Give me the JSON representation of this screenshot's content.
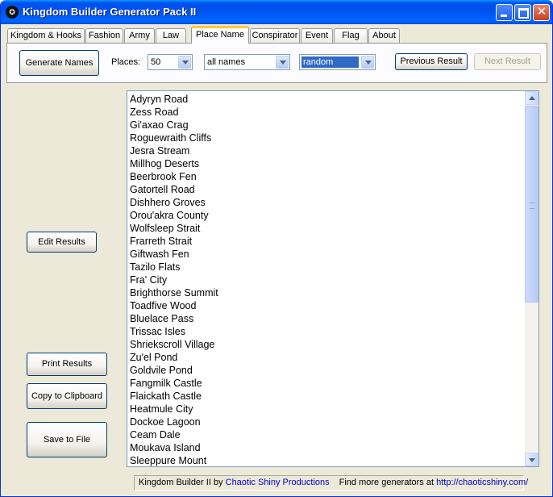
{
  "window": {
    "title": "Kingdom Builder Generator Pack II",
    "icon_glyph": "✪"
  },
  "tabs": [
    {
      "label": "Kingdom & Hooks",
      "active": false
    },
    {
      "label": "Fashion",
      "active": false
    },
    {
      "label": "Army",
      "active": false
    },
    {
      "label": "Law",
      "active": false
    },
    {
      "label": "Place Name",
      "active": true
    },
    {
      "label": "Conspirator",
      "active": false
    },
    {
      "label": "Event",
      "active": false
    },
    {
      "label": "Flag",
      "active": false
    },
    {
      "label": "About",
      "active": false
    }
  ],
  "toolbar": {
    "generate_label": "Generate Names",
    "places_label": "Places:",
    "places_value": "50",
    "filter_value": "all names",
    "style_value": "random",
    "previous_label": "Previous Result",
    "next_label": "Next Result"
  },
  "side_buttons": {
    "edit": "Edit Results",
    "print": "Print Results",
    "copy": "Copy to Clipboard",
    "save": "Save to File"
  },
  "results": [
    "Adyryn Road",
    "Zess Road",
    "Gi'axao Crag",
    "Roguewraith Cliffs",
    "Jesra Stream",
    "Millhog Deserts",
    "Beerbrook Fen",
    "Gatortell Road",
    "Dishhero Groves",
    "Orou'akra County",
    "Wolfsleep Strait",
    "Frarreth Strait",
    "Giftwash Fen",
    "Tazilo Flats",
    "Fra' City",
    "Brighthorse Summit",
    "Toadfive Wood",
    "Bluelace Pass",
    "Trissac Isles",
    "Shriekscroll Village",
    "Zu'el Pond",
    "Goldvile Pond",
    "Fangmilk Castle",
    "Flaickath Castle",
    "Heatmule City",
    "Dockoe Lagoon",
    "Ceam Dale",
    "Moukava Island",
    "Sleeppure Mount"
  ],
  "status": {
    "prefix": "Kingdom Builder II by ",
    "company": "Chaotic Shiny Productions",
    "middle": "Find more generators at ",
    "url": "http://chaoticshiny.com/"
  },
  "colors": {
    "titlebar": "#0053ee",
    "window_bg": "#ece9d8",
    "tab_highlight": "#ffc83c",
    "selection": "#316ac5",
    "link": "#0000cc"
  }
}
